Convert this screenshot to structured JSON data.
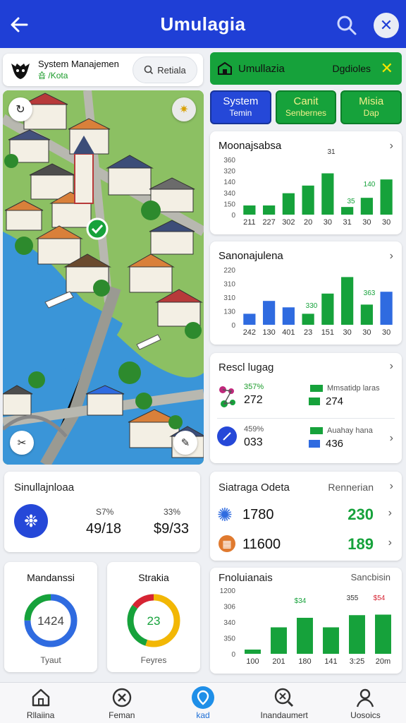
{
  "header": {
    "title": "Umulagia"
  },
  "system": {
    "name": "System Manajemen",
    "subtitle": "숍 /Kota",
    "search_label": "Retiala"
  },
  "greenbar": {
    "label": "Umullazia",
    "right_label": "Dgdioles"
  },
  "tabs": [
    {
      "label": "System",
      "sub": "Temin"
    },
    {
      "label": "Canit",
      "sub": "Senbernes"
    },
    {
      "label": "Misia",
      "sub": "Dap"
    }
  ],
  "chart1": {
    "title": "Moonajsabsa",
    "chart_data": {
      "type": "bar",
      "title": "Moonajsabsa",
      "categories": [
        "211",
        "227",
        "302",
        "20",
        "30",
        "31",
        "30",
        "30"
      ],
      "values": [
        60,
        60,
        140,
        190,
        270,
        50,
        110,
        230
      ],
      "y_ticks": [
        "360",
        "320",
        "140",
        "340",
        "150",
        "0"
      ],
      "data_labels": [
        "31",
        "35",
        "140"
      ],
      "ylim": [
        0,
        360
      ],
      "series_colors": [
        "#16a23b"
      ]
    }
  },
  "chart2": {
    "title": "Sanonajulena",
    "chart_data": {
      "type": "bar",
      "title": "Sanonajulena",
      "categories": [
        "242",
        "130",
        "401",
        "23",
        "151",
        "30",
        "30",
        "30"
      ],
      "values": [
        60,
        130,
        95,
        60,
        170,
        260,
        110,
        180
      ],
      "colors": [
        "#2f6be0",
        "#2f6be0",
        "#2f6be0",
        "#16a23b",
        "#16a23b",
        "#16a23b",
        "#16a23b",
        "#2f6be0"
      ],
      "y_ticks": [
        "220",
        "310",
        "310",
        "130",
        "0"
      ],
      "data_labels": [
        "330",
        "363"
      ],
      "ylim": [
        0,
        300
      ]
    }
  },
  "result": {
    "title": "Rescl lugag",
    "rows": [
      {
        "pct": "357%",
        "value": "272",
        "legend": "Mmsatidp laras",
        "value2": "274",
        "legend_color": "#16a23b",
        "value2_color": "#16a23b"
      },
      {
        "pct": "459%",
        "value": "033",
        "legend": "Auahay hana",
        "value2": "436",
        "legend_color": "#16a23b",
        "value2_color": "#2f6be0"
      }
    ]
  },
  "simulation": {
    "title": "Sinullajnloaa",
    "pct1": "S7%",
    "val1": "49/18",
    "pct2": "33%",
    "val2": "$9/33"
  },
  "stat": {
    "title": "Siatraga Odeta",
    "right": "Rennerian",
    "rows": [
      {
        "value": "1780",
        "green": "230"
      },
      {
        "value": "11600",
        "green": "189"
      }
    ]
  },
  "donut1": {
    "title": "Mandanssi",
    "value": "1424",
    "foot": "Tyaut",
    "fraction": 0.75,
    "colors": [
      "#2f6be0",
      "#16a23b"
    ]
  },
  "donut2": {
    "title": "Strakia",
    "value": "23",
    "foot": "Feyres",
    "fraction": 0.55,
    "colors": [
      "#f2b705",
      "#16a23b",
      "#d62433"
    ]
  },
  "chart3": {
    "title": "Fnoluianais",
    "right": "Sancbisin",
    "chart_data": {
      "type": "bar",
      "title": "Fnoluianais",
      "categories": [
        "100",
        "201",
        "180",
        "141",
        "3:25",
        "20m"
      ],
      "values": [
        80,
        500,
        680,
        500,
        730,
        740
      ],
      "y_ticks": [
        "1200",
        "306",
        "340",
        "350",
        "0"
      ],
      "data_labels": [
        "$34",
        "355",
        "$54"
      ],
      "ylim": [
        0,
        1200
      ],
      "series_colors": [
        "#16a23b"
      ]
    }
  },
  "nav": [
    {
      "label": "Rllaiina",
      "icon": "home-icon",
      "active": false
    },
    {
      "label": "Feman",
      "icon": "close-circle-icon",
      "active": false
    },
    {
      "label": "kad",
      "icon": "location-icon",
      "active": true
    },
    {
      "label": "Inandaumert",
      "icon": "search-circle-icon",
      "active": false
    },
    {
      "label": "Uosoics",
      "icon": "user-icon",
      "active": false
    }
  ]
}
